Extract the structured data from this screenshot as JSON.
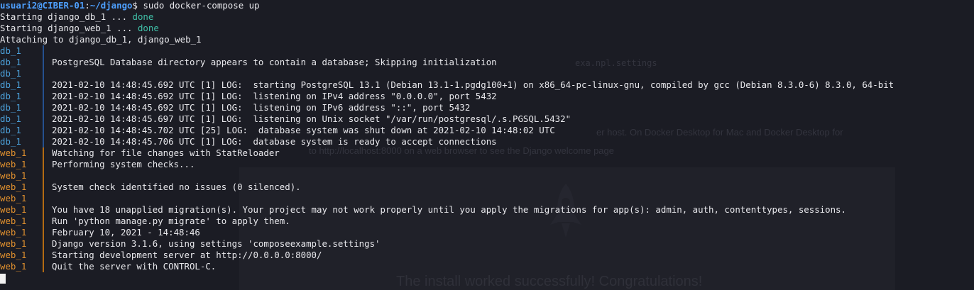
{
  "prompt": {
    "user_host": "usuari2@CIBER-01",
    "separator": ":",
    "path": "~/django",
    "symbol": "$",
    "command": "sudo docker-compose up"
  },
  "startup": [
    {
      "text": "Starting django_db_1 ... ",
      "status": "done"
    },
    {
      "text": "Starting django_web_1 ... ",
      "status": "done"
    }
  ],
  "attaching": "Attaching to django_db_1, django_web_1",
  "log": [
    {
      "svc": "db_1",
      "kind": "db",
      "text": ""
    },
    {
      "svc": "db_1",
      "kind": "db",
      "text": "PostgreSQL Database directory appears to contain a database; Skipping initialization"
    },
    {
      "svc": "db_1",
      "kind": "db",
      "text": ""
    },
    {
      "svc": "db_1",
      "kind": "db",
      "text": "2021-02-10 14:48:45.692 UTC [1] LOG:  starting PostgreSQL 13.1 (Debian 13.1-1.pgdg100+1) on x86_64-pc-linux-gnu, compiled by gcc (Debian 8.3.0-6) 8.3.0, 64-bit"
    },
    {
      "svc": "db_1",
      "kind": "db",
      "text": "2021-02-10 14:48:45.692 UTC [1] LOG:  listening on IPv4 address \"0.0.0.0\", port 5432"
    },
    {
      "svc": "db_1",
      "kind": "db",
      "text": "2021-02-10 14:48:45.692 UTC [1] LOG:  listening on IPv6 address \"::\", port 5432"
    },
    {
      "svc": "db_1",
      "kind": "db",
      "text": "2021-02-10 14:48:45.697 UTC [1] LOG:  listening on Unix socket \"/var/run/postgresql/.s.PGSQL.5432\""
    },
    {
      "svc": "db_1",
      "kind": "db",
      "text": "2021-02-10 14:48:45.702 UTC [25] LOG:  database system was shut down at 2021-02-10 14:48:02 UTC"
    },
    {
      "svc": "db_1",
      "kind": "db",
      "text": "2021-02-10 14:48:45.706 UTC [1] LOG:  database system is ready to accept connections"
    },
    {
      "svc": "web_1",
      "kind": "web",
      "text": "Watching for file changes with StatReloader"
    },
    {
      "svc": "web_1",
      "kind": "web",
      "text": "Performing system checks..."
    },
    {
      "svc": "web_1",
      "kind": "web",
      "text": ""
    },
    {
      "svc": "web_1",
      "kind": "web",
      "text": "System check identified no issues (0 silenced)."
    },
    {
      "svc": "web_1",
      "kind": "web",
      "text": ""
    },
    {
      "svc": "web_1",
      "kind": "web",
      "text": "You have 18 unapplied migration(s). Your project may not work properly until you apply the migrations for app(s): admin, auth, contenttypes, sessions."
    },
    {
      "svc": "web_1",
      "kind": "web",
      "text": "Run 'python manage.py migrate' to apply them."
    },
    {
      "svc": "web_1",
      "kind": "web",
      "text": "February 10, 2021 - 14:48:46"
    },
    {
      "svc": "web_1",
      "kind": "web",
      "text": "Django version 3.1.6, using settings 'composeexample.settings'"
    },
    {
      "svc": "web_1",
      "kind": "web",
      "text": "Starting development server at http://0.0.0.0:8000/"
    },
    {
      "svc": "web_1",
      "kind": "web",
      "text": "Quit the server with CONTROL-C."
    }
  ],
  "background": {
    "settings_fragment": "exa.npl.settings",
    "docker_hint": "er host. On Docker Desktop for Mac and Docker Desktop for",
    "url_hint": "to  http://localhost:8000  on a web browser to see the Django welcome page",
    "install_message": "The install worked successfully! Congratulations!"
  }
}
